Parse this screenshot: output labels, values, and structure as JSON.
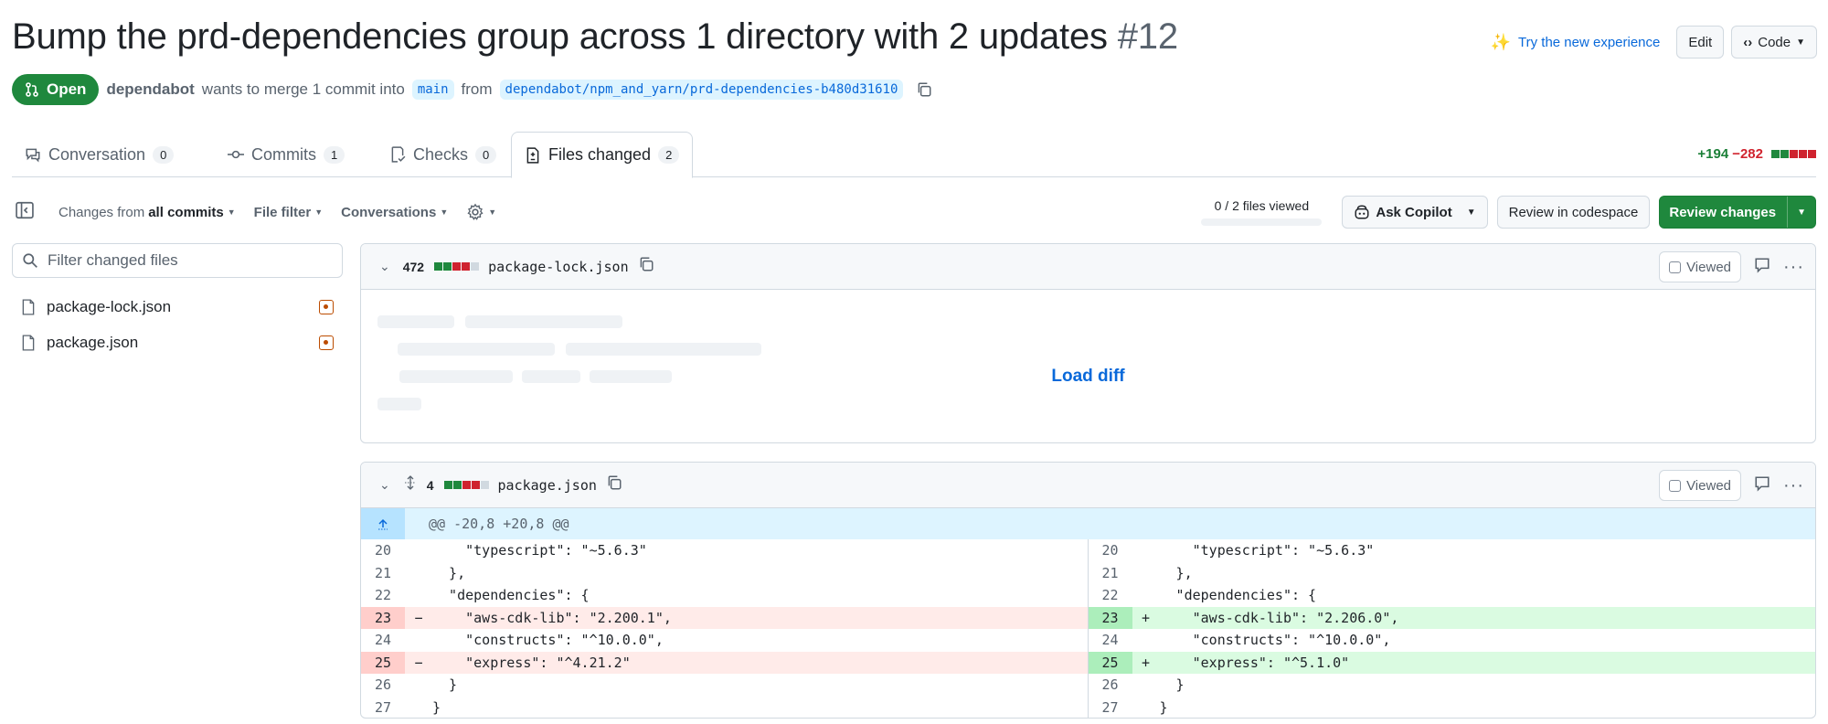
{
  "pr": {
    "title": "Bump the prd-dependencies group across 1 directory with 2 updates",
    "number": "#12",
    "state": "Open",
    "author": "dependabot",
    "merge_text": "wants to merge 1 commit into",
    "base_branch": "main",
    "from_text": "from",
    "head_branch": "dependabot/npm_and_yarn/prd-dependencies-b480d31610"
  },
  "header": {
    "new_experience": "Try the new experience",
    "edit_label": "Edit",
    "code_label": "Code"
  },
  "tabs": [
    {
      "label": "Conversation",
      "count": "0"
    },
    {
      "label": "Commits",
      "count": "1"
    },
    {
      "label": "Checks",
      "count": "0"
    },
    {
      "label": "Files changed",
      "count": "2"
    }
  ],
  "diffstat": {
    "additions": "+194",
    "deletions": "−282"
  },
  "toolbar": {
    "changes_from_prefix": "Changes from",
    "changes_from_value": "all commits",
    "file_filter": "File filter",
    "conversations": "Conversations",
    "files_viewed": "0 / 2 files viewed",
    "viewed_fraction": 0,
    "ask_copilot": "Ask Copilot",
    "review_codespace": "Review in codespace",
    "review_changes": "Review changes"
  },
  "sidebar": {
    "filter_placeholder": "Filter changed files",
    "files": [
      "package-lock.json",
      "package.json"
    ]
  },
  "files": [
    {
      "changes": "472",
      "name": "package-lock.json",
      "viewed_label": "Viewed",
      "load_diff": "Load diff"
    },
    {
      "changes": "4",
      "name": "package.json",
      "viewed_label": "Viewed"
    }
  ],
  "diff": {
    "hunk_header": "@@ -20,8 +20,8 @@",
    "left": [
      {
        "ln": "20",
        "type": "ctx",
        "sign": "",
        "code": "    \"typescript\": \"~5.6.3\""
      },
      {
        "ln": "21",
        "type": "ctx",
        "sign": "",
        "code": "  },"
      },
      {
        "ln": "22",
        "type": "ctx",
        "sign": "",
        "code": "  \"dependencies\": {"
      },
      {
        "ln": "23",
        "type": "del",
        "sign": "−",
        "code": "    \"aws-cdk-lib\": \"2.200.1\","
      },
      {
        "ln": "24",
        "type": "ctx",
        "sign": "",
        "code": "    \"constructs\": \"^10.0.0\","
      },
      {
        "ln": "25",
        "type": "del",
        "sign": "−",
        "code": "    \"express\": \"^4.21.2\""
      },
      {
        "ln": "26",
        "type": "ctx",
        "sign": "",
        "code": "  }"
      },
      {
        "ln": "27",
        "type": "ctx",
        "sign": "",
        "code": "}"
      }
    ],
    "right": [
      {
        "ln": "20",
        "type": "ctx",
        "sign": "",
        "code": "    \"typescript\": \"~5.6.3\""
      },
      {
        "ln": "21",
        "type": "ctx",
        "sign": "",
        "code": "  },"
      },
      {
        "ln": "22",
        "type": "ctx",
        "sign": "",
        "code": "  \"dependencies\": {"
      },
      {
        "ln": "23",
        "type": "add",
        "sign": "+",
        "code": "    \"aws-cdk-lib\": \"2.206.0\","
      },
      {
        "ln": "24",
        "type": "ctx",
        "sign": "",
        "code": "    \"constructs\": \"^10.0.0\","
      },
      {
        "ln": "25",
        "type": "add",
        "sign": "+",
        "code": "    \"express\": \"^5.1.0\""
      },
      {
        "ln": "26",
        "type": "ctx",
        "sign": "",
        "code": "  }"
      },
      {
        "ln": "27",
        "type": "ctx",
        "sign": "",
        "code": "}"
      }
    ]
  }
}
